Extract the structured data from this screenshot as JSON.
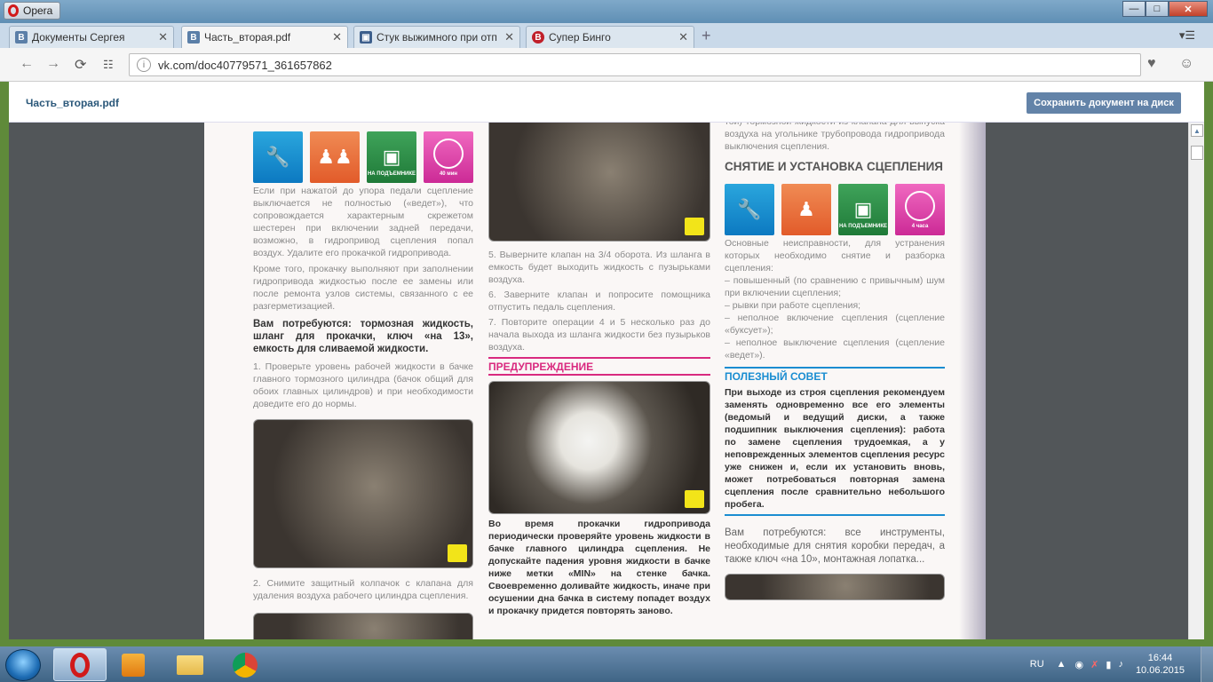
{
  "window": {
    "app_name": "Opera"
  },
  "tabs": [
    {
      "label": "Документы Сергея",
      "favicon": "В",
      "color": "#5b7fa8",
      "active": false
    },
    {
      "label": "Часть_вторая.pdf",
      "favicon": "В",
      "color": "#5b7fa8",
      "active": true
    },
    {
      "label": "Стук выжимного при отп",
      "favicon": "car",
      "color": "#3d5f8c",
      "active": false
    },
    {
      "label": "Супер Бинго",
      "favicon": "B",
      "color": "#c0202a",
      "active": false
    }
  ],
  "address": {
    "url": "vk.com/doc40779571_361657862"
  },
  "vk": {
    "doc_title": "Часть_вторая.pdf",
    "save_button": "Сохранить документ на диск"
  },
  "pdf": {
    "col1": {
      "icon_badges": [
        "НА ПОДЪЕМНИКЕ",
        "40 мин"
      ],
      "p1": "Если при нажатой до упора педали сцепление выключается не полностью («ведет»), что сопровождается характерным скрежетом шестерен при включении задней передачи, возможно, в гидропривод сцепления попал воздух. Удалите его прокачкой гидропривода.",
      "p2": "Кроме того, прокачку выполняют при заполнении гидропривода жидкостью после ее замены или после ремонта узлов системы, связанного с ее разгерметизацией.",
      "need": "Вам потребуются: тормозная жидкость, шланг для прокачки, ключ «на 13», емкость для сливаемой жидкости.",
      "step1": "1. Проверьте уровень рабочей жидкости в бачке главного тормозного цилиндра (бачок общий для обоих главных цилиндров) и при необходимости доведите его до нормы.",
      "step2": "2. Снимите защитный колпачок с клапана для удаления воздуха рабочего цилиндра сцепления."
    },
    "col2": {
      "step5": "5. Выверните клапан на 3/4 оборота. Из шланга в емкость будет выходить жидкость с пузырьками воздуха.",
      "step6": "6. Заверните клапан и попросите помощника отпустить педаль сцепления.",
      "step7": "7. Повторите операции 4 и 5 несколько раз до начала выхода из шланга жидкости без пузырьков воздуха.",
      "warning_title": "ПРЕДУПРЕЖДЕНИЕ",
      "warning_text": "Во время прокачки гидропривода периодически проверяйте уровень жидкости в бачке главного цилиндра сцепления. Не допускайте падения уровня жидкости в бачке ниже метки «MIN» на стенке бачка. Своевременно доливайте жидкость, иначе при осушении дна бачка в систему попадет воздух и прокачку придется повторять заново."
    },
    "col3": {
      "top_text": "той) тормозной жидкости из клапана для выпуска воздуха на угольнике трубопровода гидропривода выключения сцепления.",
      "section_title": "СНЯТИЕ И УСТАНОВКА СЦЕПЛЕНИЯ",
      "icon_badges": [
        "НА ПОДЪЕМНИКЕ",
        "4 часа"
      ],
      "intro": "Основные неисправности, для устранения которых необходимо снятие и разборка сцепления:",
      "faults": [
        "– повышенный (по сравнению с привычным) шум при включении сцепления;",
        "– рывки при работе сцепления;",
        "– неполное включение сцепления (сцепление «буксует»);",
        "– неполное выключение сцепления (сцепление «ведет»)."
      ],
      "tip_title": "ПОЛЕЗНЫЙ СОВЕТ",
      "tip_text": "При выходе из строя сцепления рекомендуем заменять одновременно все его элементы (ведомый и ведущий диски, а также подшипник выключения сцепления): работа по замене сцепления трудоемкая, а у неповрежденных элементов сцепления ресурс уже снижен и, если их установить вновь, может потребоваться повторная замена сцепления после сравнительно небольшого пробега.",
      "need": "Вам потребуются: все инструменты, необходимые для снятия коробки передач, а также ключ «на 10», монтажная лопатка..."
    }
  },
  "taskbar": {
    "lang": "RU",
    "time": "16:44",
    "date": "10.06.2015"
  }
}
